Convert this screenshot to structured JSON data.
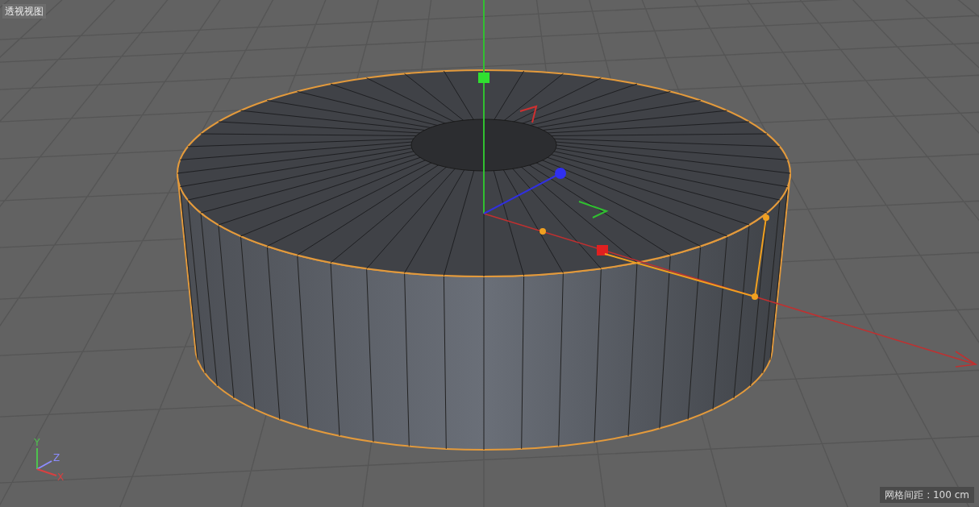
{
  "viewport": {
    "title": "透视视图",
    "grid_spacing": "网格间距 : 100 cm",
    "axes": [
      {
        "label": "Y",
        "color": "#4ec24e"
      },
      {
        "label": "Z",
        "color": "#8c8cff"
      },
      {
        "label": "X",
        "color": "#d84040"
      }
    ]
  }
}
